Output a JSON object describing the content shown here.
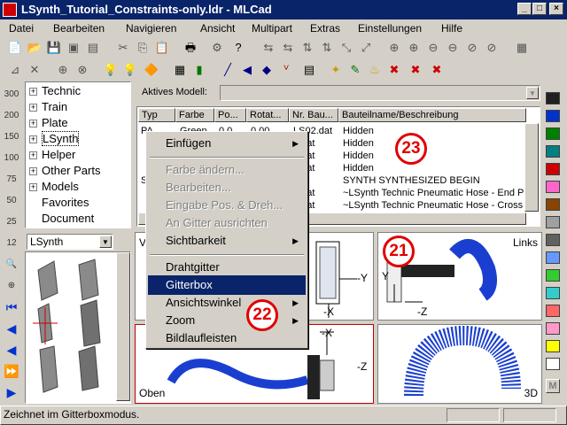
{
  "window": {
    "title": "LSynth_Tutorial_Constraints-only.ldr - MLCad",
    "app_icon": "mlcad-app-icon",
    "controls": [
      "_",
      "□",
      "×"
    ]
  },
  "menubar": [
    "Datei",
    "Bearbeiten",
    "Navigieren",
    "Ansicht",
    "Multipart",
    "Extras",
    "Einstellungen",
    "Hilfe"
  ],
  "tree": {
    "items": [
      {
        "label": "Technic",
        "expandable": true
      },
      {
        "label": "Train",
        "expandable": true
      },
      {
        "label": "Plate",
        "expandable": true
      },
      {
        "label": "LSynth",
        "expandable": true,
        "selected": true
      },
      {
        "label": "Helper",
        "expandable": true
      },
      {
        "label": "Other Parts",
        "expandable": true
      },
      {
        "label": "Models",
        "expandable": true
      },
      {
        "label": "Favorites",
        "expandable": false
      },
      {
        "label": "Document",
        "expandable": false
      }
    ]
  },
  "parts_dropdown": {
    "value": "LSynth"
  },
  "model": {
    "label": "Aktives Modell:",
    "value": ""
  },
  "table": {
    "headers": [
      "Typ",
      "Farbe",
      "Po...",
      "Rotat...",
      "Nr. Bau...",
      "Bauteilname/Beschreibung"
    ],
    "rows": [
      {
        "typ": "PA",
        "farbe": "Green",
        "pos": "0.0...",
        "rot": "0.00...",
        "nr": "LS02.dat",
        "desc": "Hidden"
      },
      {
        "typ": "",
        "farbe": "",
        "pos": "",
        "rot": "",
        "nr": "2.dat",
        "desc": "Hidden"
      },
      {
        "typ": "",
        "farbe": "",
        "pos": "",
        "rot": "",
        "nr": "2.dat",
        "desc": "Hidden"
      },
      {
        "typ": "",
        "farbe": "",
        "pos": "",
        "rot": "",
        "nr": "2.dat",
        "desc": "Hidden"
      },
      {
        "typ": "S",
        "farbe": "",
        "pos": "",
        "rot": "",
        "nr": "",
        "desc": "SYNTH SYNTHESIZED BEGIN"
      },
      {
        "typ": "",
        "farbe": "",
        "pos": "",
        "rot": "",
        "nr": "0.dat",
        "desc": "~LSynth Technic Pneumatic Hose - End Pi"
      },
      {
        "typ": "",
        "farbe": "",
        "pos": "",
        "rot": "",
        "nr": "1.dat",
        "desc": "~LSynth Technic Pneumatic Hose - Cross S"
      }
    ]
  },
  "context_menu": {
    "items": [
      {
        "label": "Einfügen",
        "enabled": true,
        "submenu": true
      },
      {
        "label": "Farbe ändern...",
        "enabled": false
      },
      {
        "label": "Bearbeiten...",
        "enabled": false
      },
      {
        "label": "Eingabe Pos. & Dreh...",
        "enabled": false
      },
      {
        "label": "An Gitter ausrichten",
        "enabled": false
      },
      {
        "label": "Sichtbarkeit",
        "enabled": true,
        "submenu": true
      },
      {
        "label": "Drahtgitter",
        "enabled": true
      },
      {
        "label": "Gitterbox",
        "enabled": true,
        "selected": true
      },
      {
        "label": "Ansichtswinkel",
        "enabled": true,
        "submenu": true
      },
      {
        "label": "Zoom",
        "enabled": true,
        "submenu": true
      },
      {
        "label": "Bildlaufleisten",
        "enabled": true
      }
    ]
  },
  "viewports": {
    "links": "Links",
    "oben": "Oben",
    "3d": "3D",
    "v": "V",
    "axes": {
      "y": "-Y",
      "z": "-Z",
      "x": "-X",
      "y2": "Y"
    }
  },
  "annotations": {
    "a21": "21",
    "a22": "22",
    "a23": "23"
  },
  "palette": [
    "#202020",
    "#0033cc",
    "#008000",
    "#008080",
    "#cc0000",
    "#ff66cc",
    "#884400",
    "#a0a0a0",
    "#606060",
    "#6699ff",
    "#33cc33",
    "#33cccc",
    "#ff6666",
    "#ff99cc",
    "#ffff00",
    "#ffffff"
  ],
  "statusbar": {
    "text": "Zeichnet im Gitterboxmodus."
  }
}
